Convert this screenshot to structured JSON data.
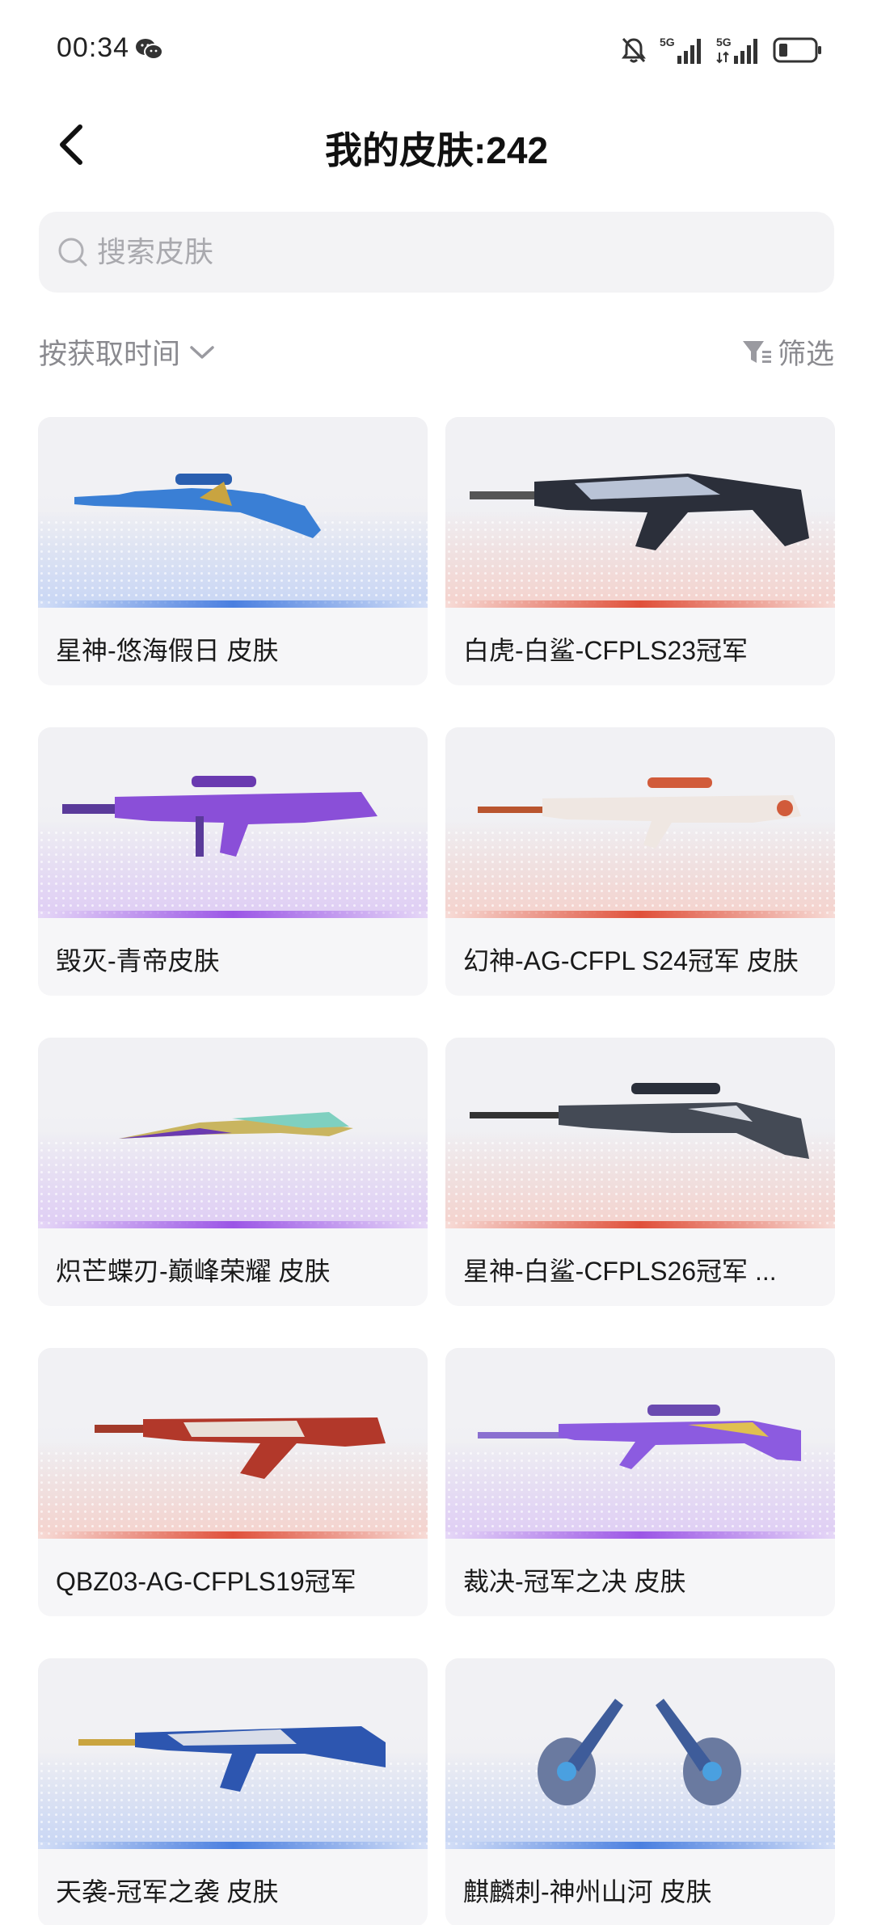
{
  "status": {
    "time": "00:34",
    "icons": [
      "wechat-icon",
      "mute-bell-icon",
      "signal-5g-icon",
      "signal-5g-icon",
      "battery-icon"
    ],
    "network_labels": [
      "5G",
      "5G"
    ]
  },
  "header": {
    "title": "我的皮肤:242",
    "back_icon": "chevron-left-icon"
  },
  "search": {
    "placeholder": "搜索皮肤",
    "value": ""
  },
  "toolbar": {
    "sort_label": "按获取时间",
    "filter_label": "筛选"
  },
  "skins": [
    {
      "name": "星神-悠海假日 皮肤",
      "rarity_color": "#4a7fe0",
      "tint": "#c8d6f5"
    },
    {
      "name": "白虎-白鲨-CFPLS23冠军",
      "rarity_color": "#e0503a",
      "tint": "#f5d2cc"
    },
    {
      "name": "毁灭-青帝皮肤",
      "rarity_color": "#9b55e6",
      "tint": "#dfcdf5"
    },
    {
      "name": "幻神-AG-CFPL S24冠军 皮肤",
      "rarity_color": "#e0503a",
      "tint": "#f5d2cc"
    },
    {
      "name": "炽芒蝶刃-巅峰荣耀 皮肤",
      "rarity_color": "#9b55e6",
      "tint": "#dfcdf5"
    },
    {
      "name": "星神-白鲨-CFPLS26冠军 ...",
      "rarity_color": "#e0503a",
      "tint": "#f5d2cc"
    },
    {
      "name": "QBZ03-AG-CFPLS19冠军",
      "rarity_color": "#e0503a",
      "tint": "#f5d2cc"
    },
    {
      "name": "裁决-冠军之决 皮肤",
      "rarity_color": "#9b55e6",
      "tint": "#dfcdf5"
    },
    {
      "name": "天袭-冠军之袭 皮肤",
      "rarity_color": "#4a7fe0",
      "tint": "#c8d6f5"
    },
    {
      "name": "麒麟刺-神州山河 皮肤",
      "rarity_color": "#4a7fe0",
      "tint": "#c8d6f5"
    }
  ]
}
